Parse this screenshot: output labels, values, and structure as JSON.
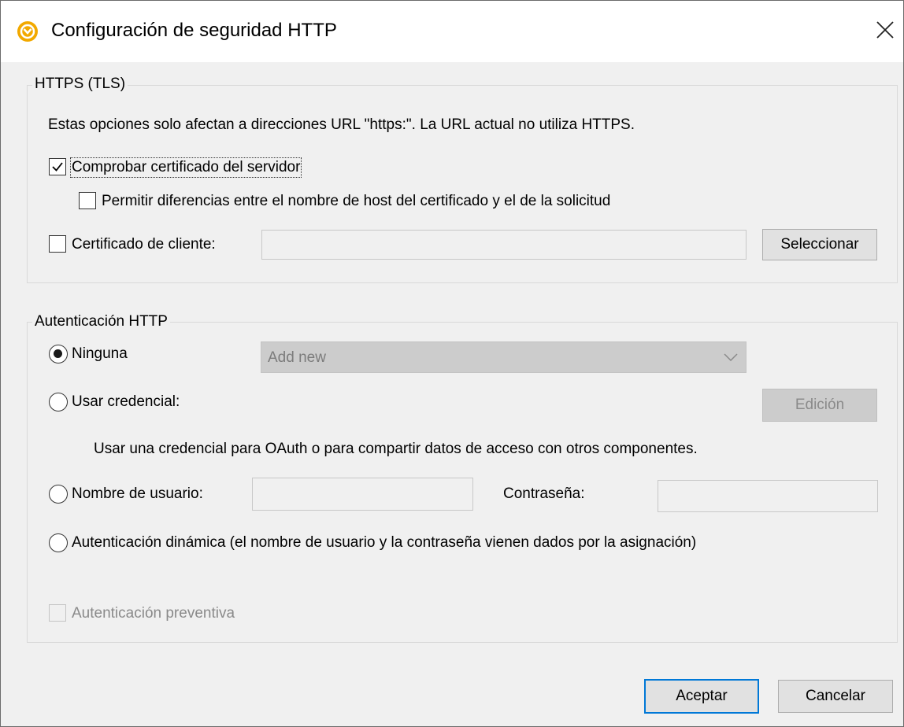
{
  "window": {
    "title": "Configuración de seguridad HTTP",
    "close_label": "×"
  },
  "https_group": {
    "legend": "HTTPS (TLS)",
    "info": "Estas opciones solo afectan a direcciones URL \"https:\". La URL actual no utiliza HTTPS.",
    "check_server_cert": {
      "label": "Comprobar certificado del servidor",
      "checked": true
    },
    "allow_host_mismatch": {
      "label": "Permitir diferencias entre el nombre de host del certificado y el de la solicitud",
      "checked": false
    },
    "client_cert": {
      "label": "Certificado de cliente:",
      "checked": false,
      "value": ""
    },
    "select_button": "Seleccionar"
  },
  "auth_group": {
    "legend": "Autenticación HTTP",
    "none": {
      "label": "Ninguna",
      "selected": true
    },
    "credential_select": {
      "value": "Add new"
    },
    "use_credential": {
      "label": "Usar credencial:",
      "selected": false
    },
    "edit_button": "Edición",
    "credential_info": "Usar una credencial para OAuth o para compartir datos de acceso con otros componentes.",
    "username": {
      "label": "Nombre de usuario:",
      "selected": false,
      "value": ""
    },
    "password": {
      "label": "Contraseña:",
      "value": ""
    },
    "dynamic": {
      "label": "Autenticación dinámica (el nombre de usuario y la contraseña vienen dados por la asignación)",
      "selected": false
    },
    "preemptive": {
      "label": "Autenticación preventiva",
      "checked": false,
      "disabled": true
    }
  },
  "footer": {
    "ok_button": "Aceptar",
    "cancel_button": "Cancelar"
  }
}
